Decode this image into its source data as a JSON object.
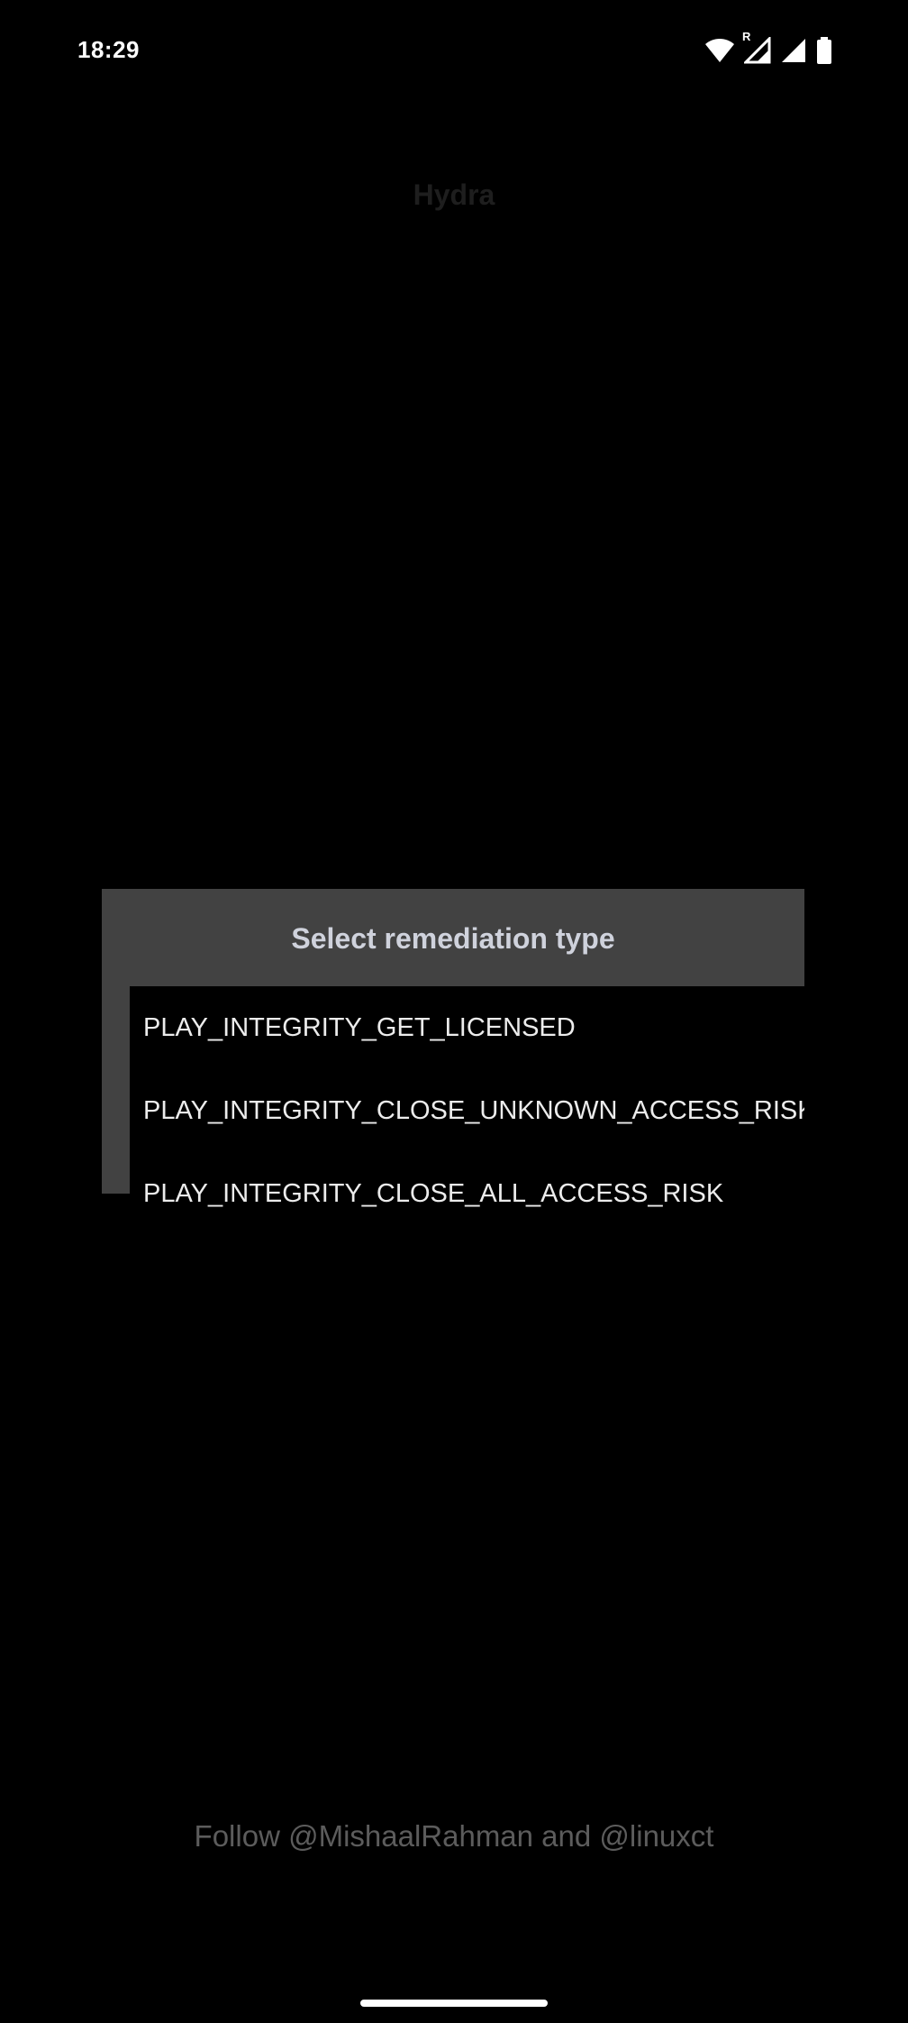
{
  "status_bar": {
    "time": "18:29",
    "icons": [
      "wifi-icon",
      "signal-roaming-icon",
      "signal-icon",
      "battery-icon"
    ],
    "roaming_badge": "R"
  },
  "app": {
    "title": "Hydra"
  },
  "dialog": {
    "title": "Select remediation type",
    "options": [
      "PLAY_INTEGRITY_GET_LICENSED",
      "PLAY_INTEGRITY_CLOSE_UNKNOWN_ACCESS_RISK",
      "PLAY_INTEGRITY_CLOSE_ALL_ACCESS_RISK"
    ]
  },
  "footer": {
    "text": "Follow @MishaalRahman and @linuxct"
  },
  "colors": {
    "background": "#000000",
    "dialog_background": "#424242",
    "dialog_title": "#cfd2dc",
    "option_text": "#ececec",
    "footer_text": "#5c5c5c"
  }
}
